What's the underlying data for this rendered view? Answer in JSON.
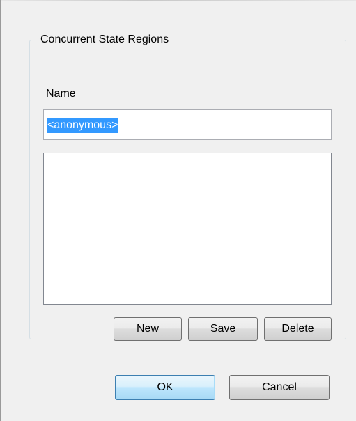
{
  "group": {
    "title": "Concurrent State Regions"
  },
  "name_field": {
    "label": "Name",
    "value": "<anonymous>"
  },
  "region_list": {
    "items": []
  },
  "buttons": {
    "new": "New",
    "save": "Save",
    "delete": "Delete",
    "ok": "OK",
    "cancel": "Cancel"
  },
  "colors": {
    "dialog_background": "#f0f0f0",
    "selection_highlight": "#3399ff",
    "default_button_border": "#3c7fb1"
  }
}
